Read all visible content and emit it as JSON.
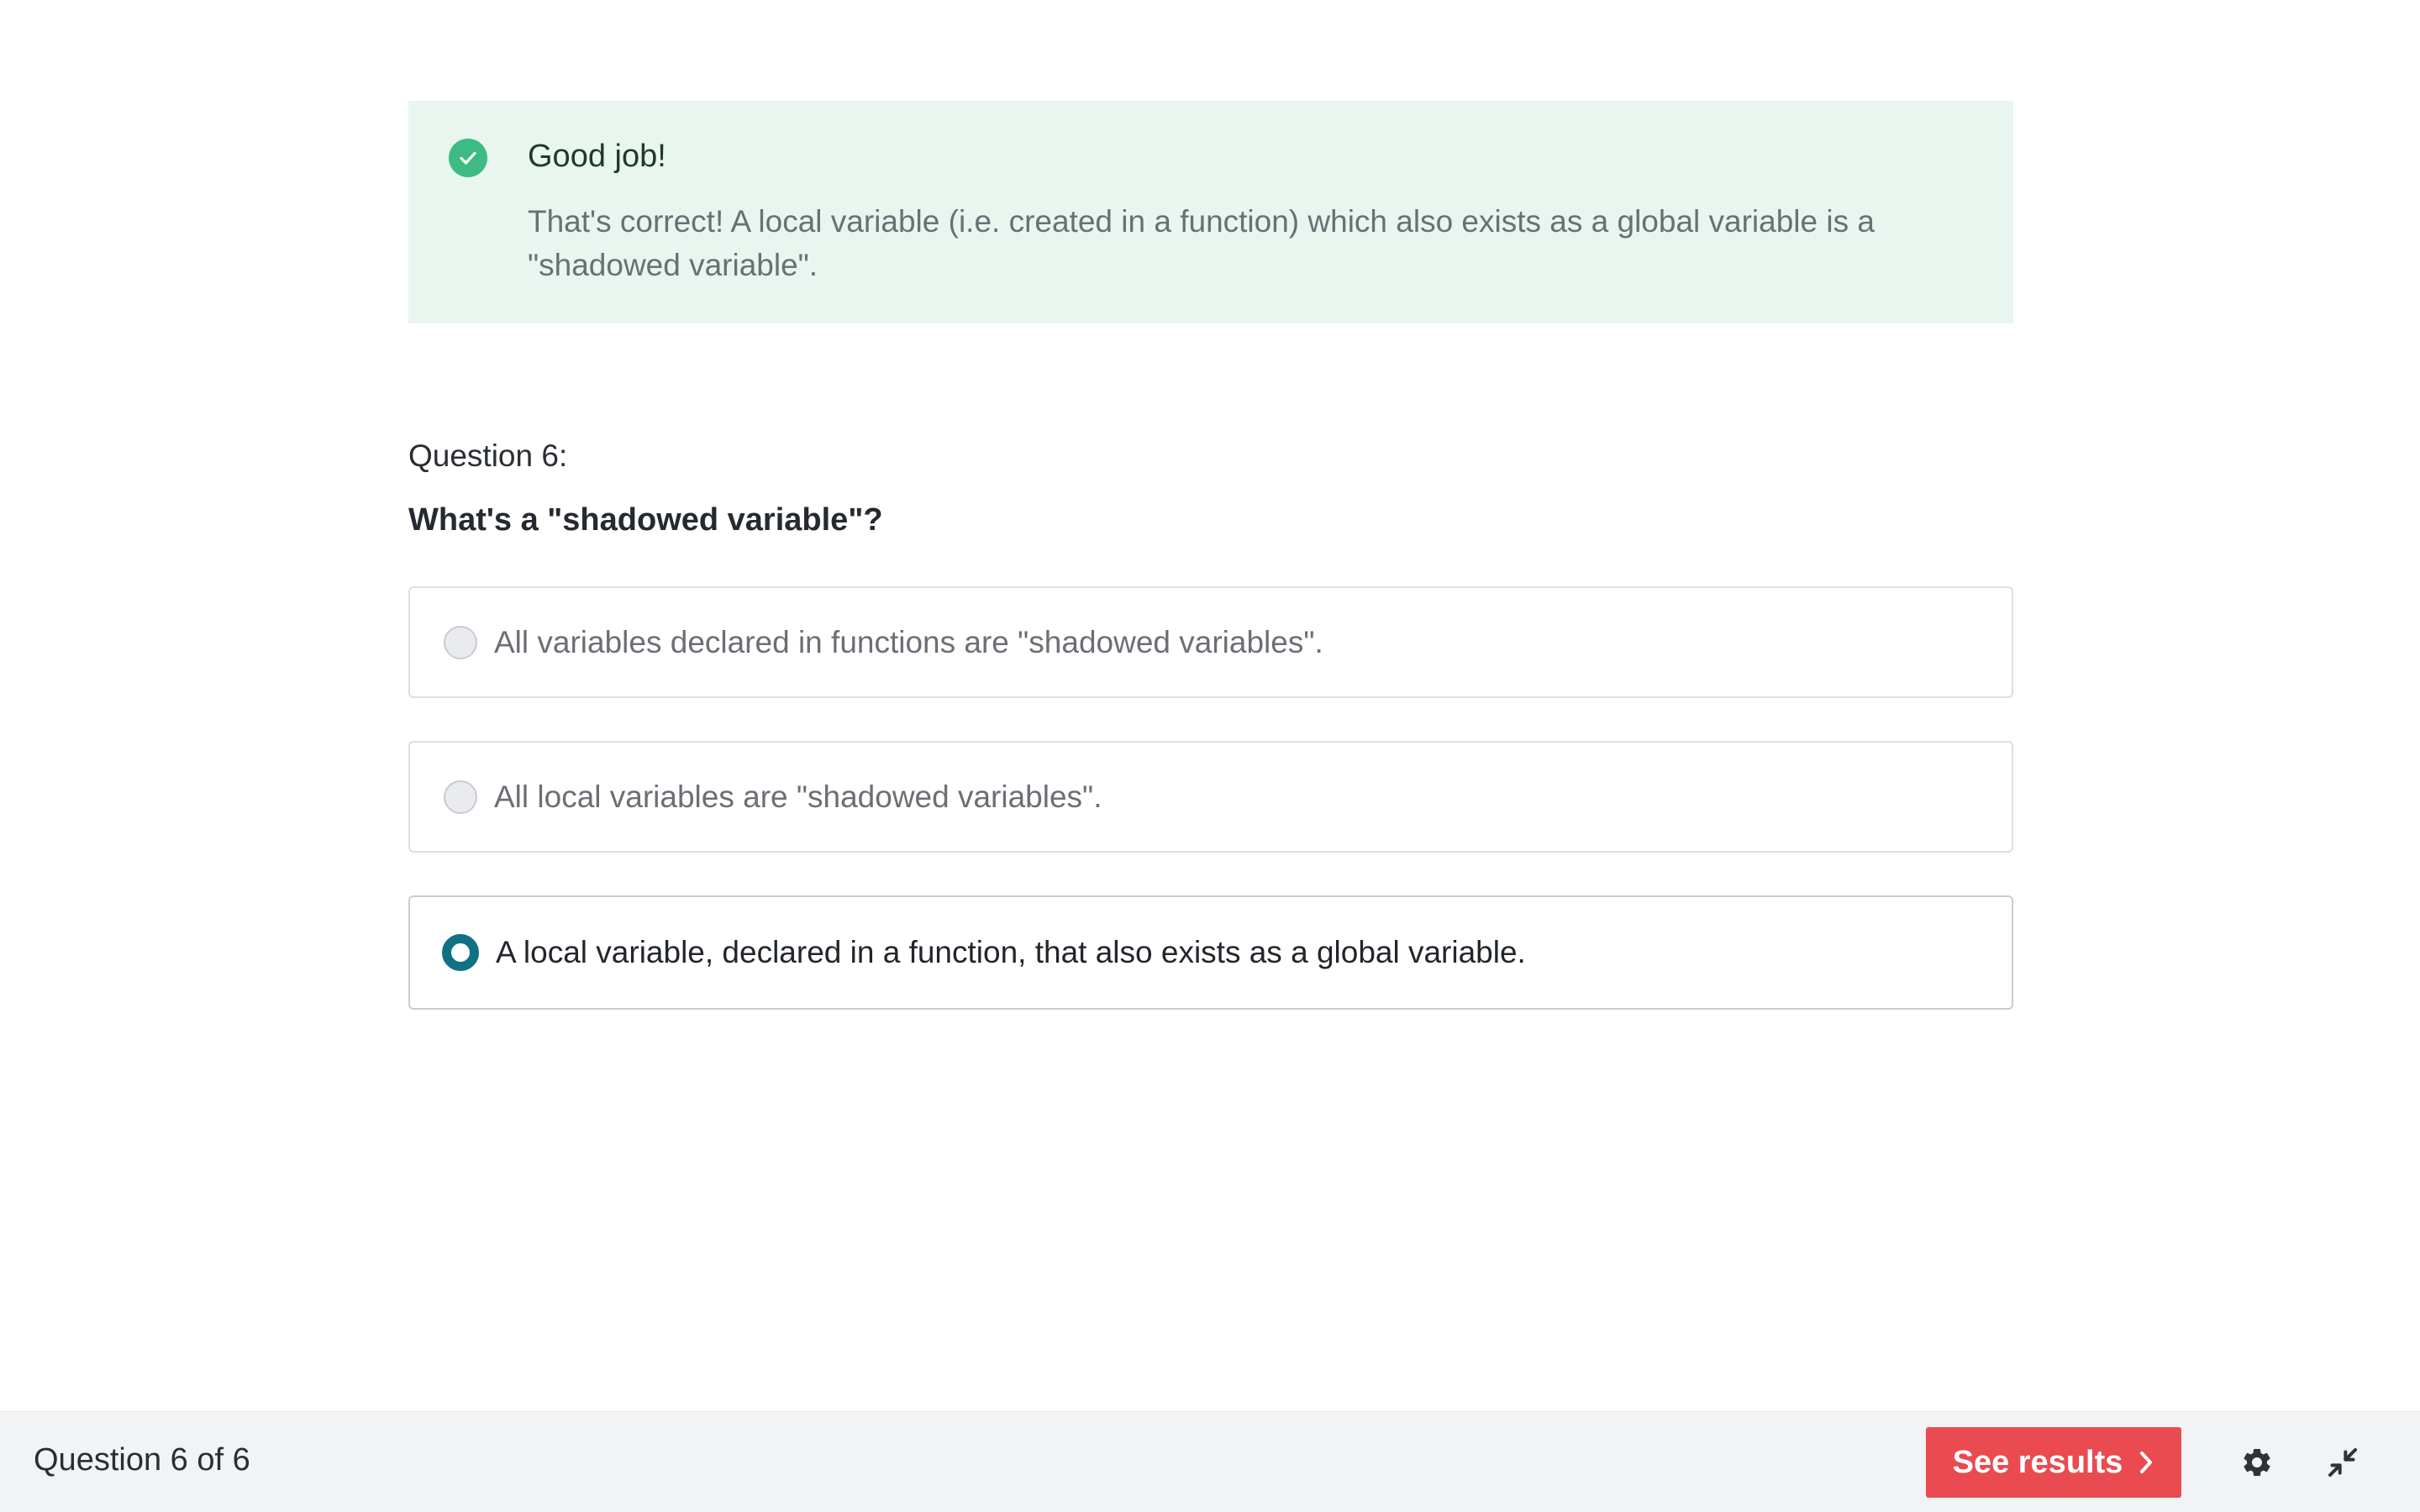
{
  "feedback": {
    "title": "Good job!",
    "message": "That's correct! A local variable (i.e. created in a function) which also exists as a global variable is a \"shadowed variable\".",
    "status": "correct",
    "icon": "check-circle-icon",
    "accent_color": "#3dbb82",
    "background_color": "#e8f6ef"
  },
  "question": {
    "number_label": "Question 6:",
    "text": "What's a \"shadowed variable\"?",
    "options": [
      {
        "label": "All variables declared in functions are \"shadowed variables\".",
        "selected": false
      },
      {
        "label": "All local variables are \"shadowed variables\".",
        "selected": false
      },
      {
        "label": "A local variable, declared in a function, that also exists as a global variable.",
        "selected": true
      }
    ],
    "selected_color": "#0f7183"
  },
  "footer": {
    "progress": "Question 6 of 6",
    "results_label": "See results",
    "results_color": "#e94b51",
    "icons": [
      "gear-icon",
      "collapse-icon"
    ]
  }
}
